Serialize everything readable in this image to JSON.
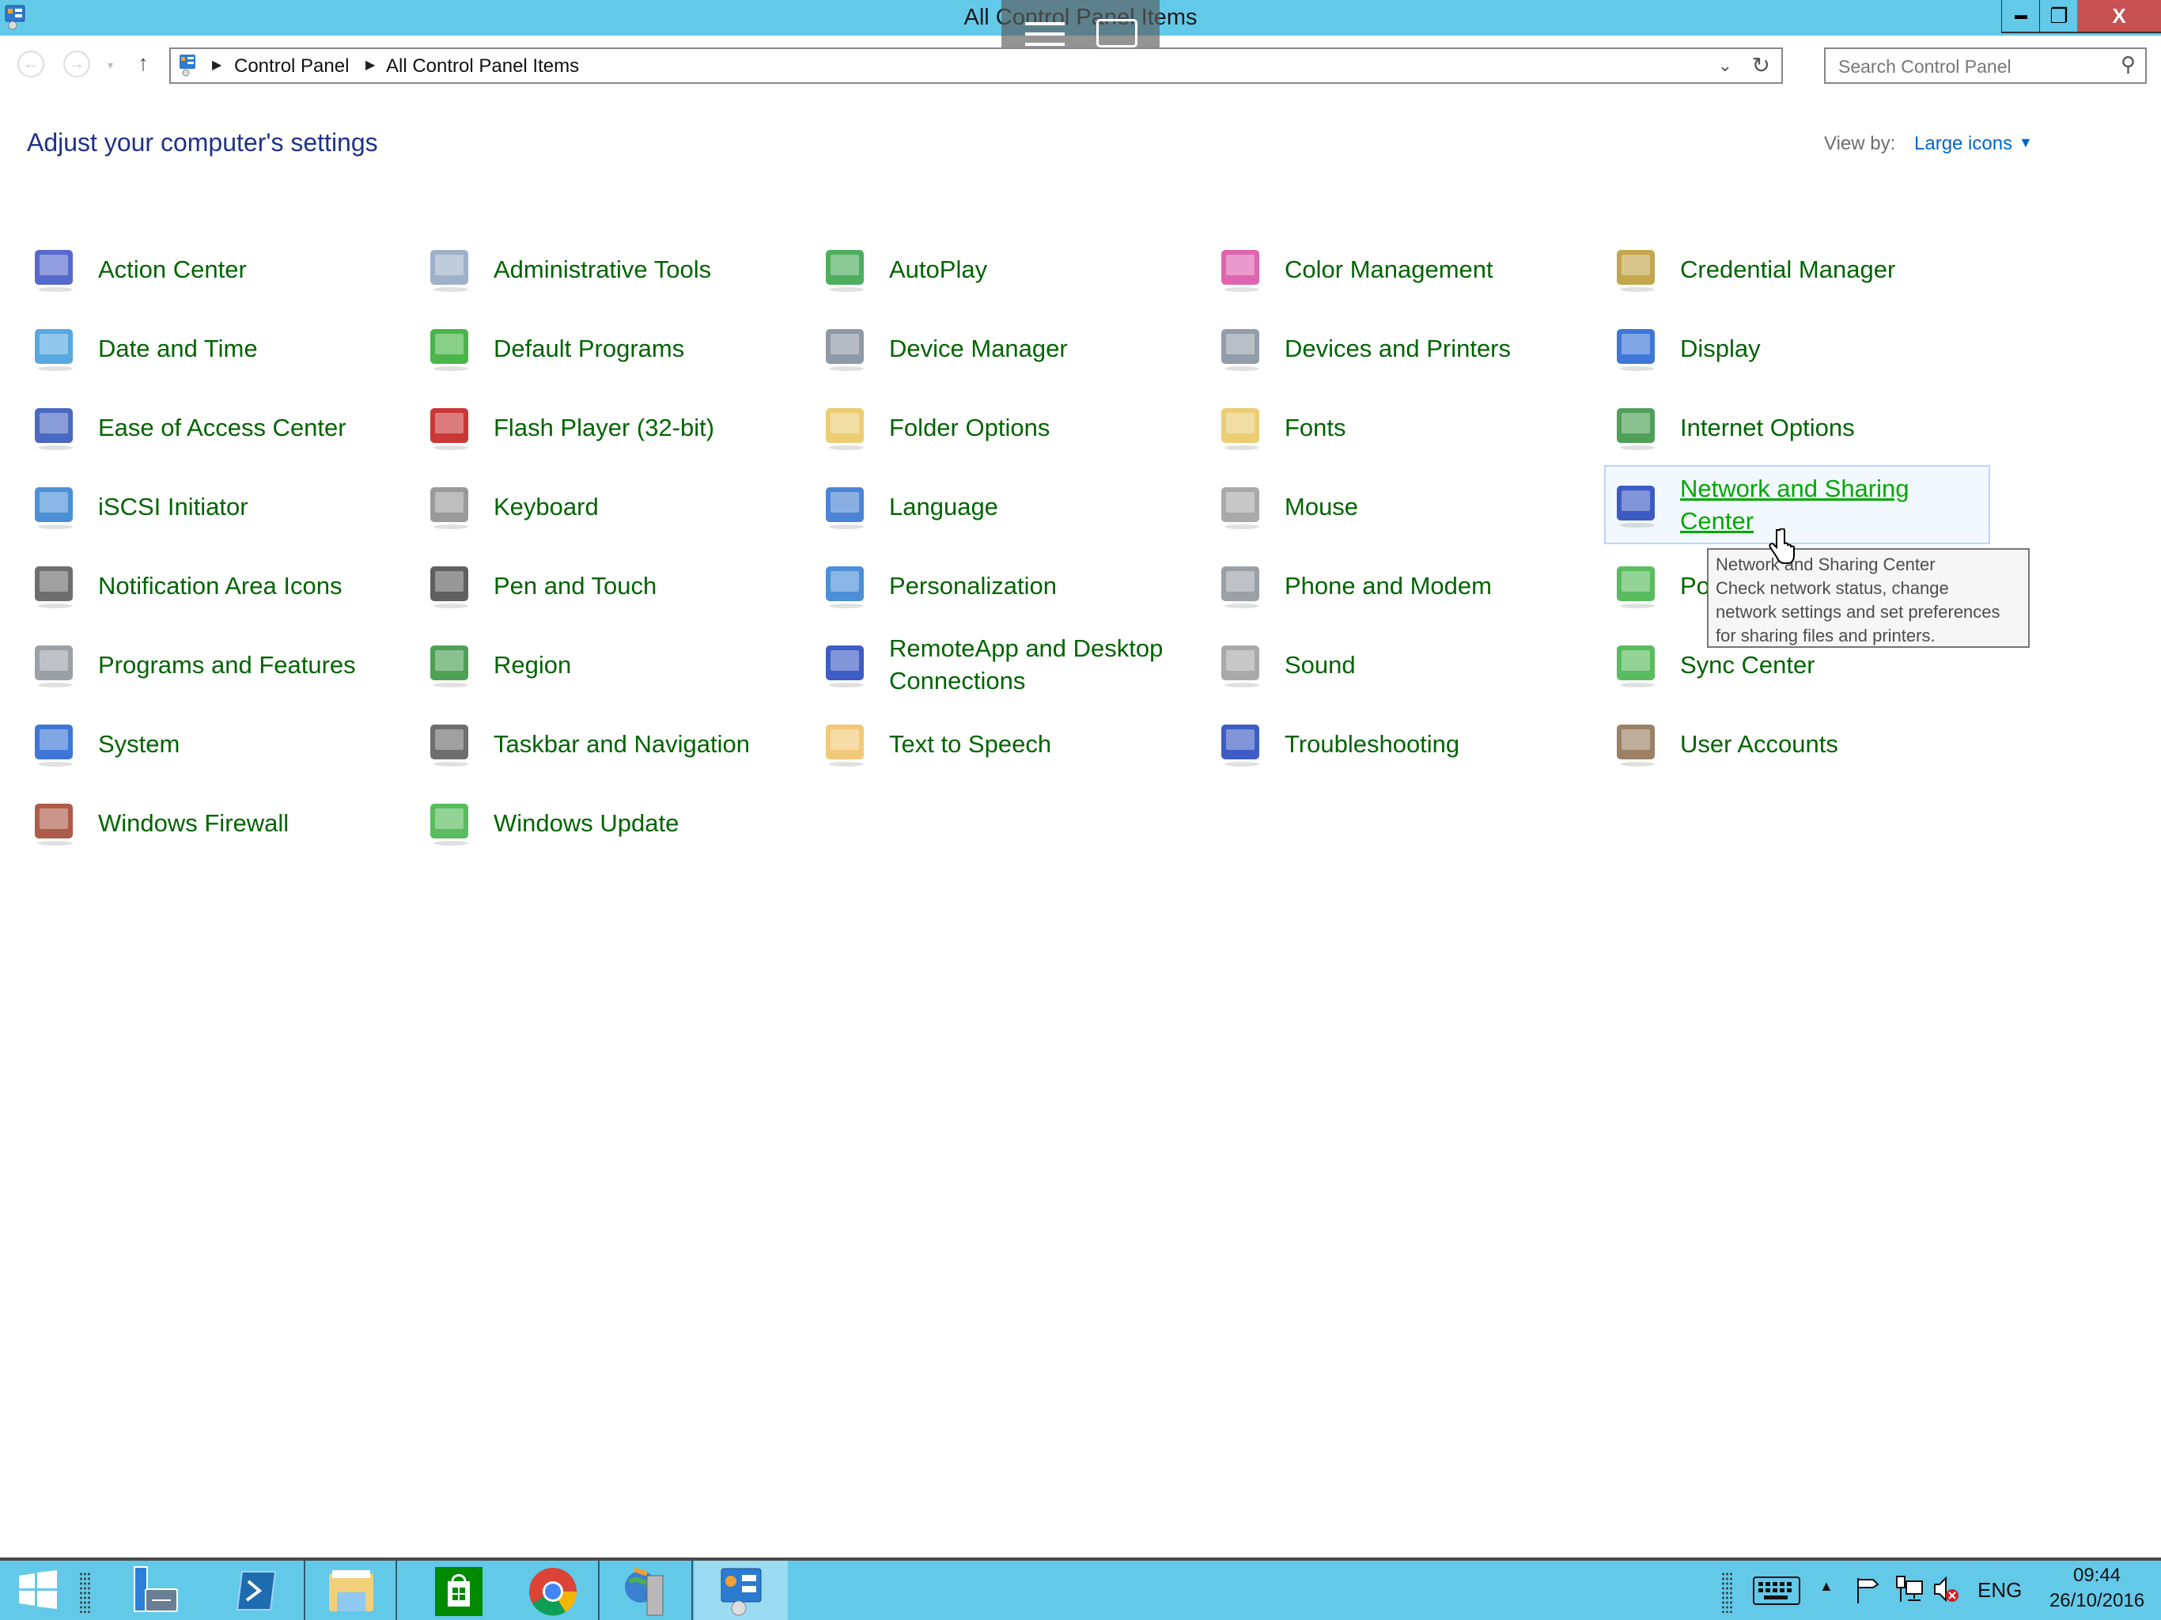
{
  "window": {
    "title": "All Control Panel Items",
    "buttons": {
      "minimize": "▬",
      "restore": "❐",
      "close": "X"
    }
  },
  "nav": {
    "back_icon": "back-arrow-icon",
    "forward_icon": "forward-arrow-icon",
    "recent_icon": "▾",
    "up_icon": "↑",
    "breadcrumb": [
      "Control Panel",
      "All Control Panel Items"
    ],
    "separator": "▶",
    "dropdown_glyph": "⌄",
    "refresh_glyph": "↻",
    "search_placeholder": "Search Control Panel",
    "search_value": "",
    "search_glyph": "⚲"
  },
  "header": {
    "title": "Adjust your computer's settings",
    "view_by_label": "View by:",
    "view_by_value": "Large icons",
    "view_by_caret": "▼"
  },
  "items": [
    {
      "label": "Action Center",
      "icon": "flag-icon",
      "color": "#3a4fc4"
    },
    {
      "label": "Administrative Tools",
      "icon": "admin-tools-icon",
      "color": "#8da3c0"
    },
    {
      "label": "AutoPlay",
      "icon": "autoplay-icon",
      "color": "#2ea043"
    },
    {
      "label": "Color Management",
      "icon": "color-management-icon",
      "color": "#d84aa0"
    },
    {
      "label": "Credential Manager",
      "icon": "credential-vault-icon",
      "color": "#b8962e"
    },
    {
      "label": "Date and Time",
      "icon": "calendar-clock-icon",
      "color": "#3a9ad9"
    },
    {
      "label": "Default Programs",
      "icon": "default-programs-icon",
      "color": "#2aa82a"
    },
    {
      "label": "Device Manager",
      "icon": "device-manager-icon",
      "color": "#7a8796"
    },
    {
      "label": "Devices and Printers",
      "icon": "printer-icon",
      "color": "#7f8c99"
    },
    {
      "label": "Display",
      "icon": "monitor-icon",
      "color": "#1c5fd0"
    },
    {
      "label": "Ease of Access Center",
      "icon": "ease-of-access-icon",
      "color": "#2b4fb8"
    },
    {
      "label": "Flash Player (32-bit)",
      "icon": "flash-player-icon",
      "color": "#c01414"
    },
    {
      "label": "Folder Options",
      "icon": "folder-options-icon",
      "color": "#e8c45c"
    },
    {
      "label": "Fonts",
      "icon": "fonts-folder-icon",
      "color": "#e8c45c"
    },
    {
      "label": "Internet Options",
      "icon": "internet-globe-icon",
      "color": "#2f8f3a"
    },
    {
      "label": "iSCSI Initiator",
      "icon": "iscsi-globe-icon",
      "color": "#2b7bd0"
    },
    {
      "label": "Keyboard",
      "icon": "keyboard-icon",
      "color": "#888888"
    },
    {
      "label": "Language",
      "icon": "language-icon",
      "color": "#2b6fd0"
    },
    {
      "label": "Mouse",
      "icon": "mouse-icon",
      "color": "#9a9a9a"
    },
    {
      "label": "Network and Sharing Center",
      "icon": "network-icon",
      "color": "#1c3fb8",
      "hover": true
    },
    {
      "label": "Notification Area Icons",
      "icon": "notification-icons-icon",
      "color": "#555555"
    },
    {
      "label": "Pen and Touch",
      "icon": "pen-icon",
      "color": "#444444"
    },
    {
      "label": "Personalization",
      "icon": "personalization-icon",
      "color": "#2b7bd0"
    },
    {
      "label": "Phone and Modem",
      "icon": "phone-modem-icon",
      "color": "#8a8f96"
    },
    {
      "label": "Power Options",
      "icon": "battery-plug-icon",
      "color": "#3cb043"
    },
    {
      "label": "Programs and Features",
      "icon": "programs-features-icon",
      "color": "#8a8f96"
    },
    {
      "label": "Region",
      "icon": "region-globe-clock-icon",
      "color": "#2f8f3a"
    },
    {
      "label": "RemoteApp and Desktop Connections",
      "icon": "remote-desktop-icon",
      "color": "#1c3fb8"
    },
    {
      "label": "Sound",
      "icon": "speaker-icon",
      "color": "#9a9a9a"
    },
    {
      "label": "Sync Center",
      "icon": "sync-icon",
      "color": "#3cb043"
    },
    {
      "label": "System",
      "icon": "computer-icon",
      "color": "#1c5fd0"
    },
    {
      "label": "Taskbar and Navigation",
      "icon": "taskbar-icon",
      "color": "#555555"
    },
    {
      "label": "Text to Speech",
      "icon": "speech-bubble-icon",
      "color": "#f0c060"
    },
    {
      "label": "Troubleshooting",
      "icon": "troubleshooting-icon",
      "color": "#1c3fb8"
    },
    {
      "label": "User Accounts",
      "icon": "users-icon",
      "color": "#8a6b4a"
    },
    {
      "label": "Windows Firewall",
      "icon": "firewall-icon",
      "color": "#a0402a"
    },
    {
      "label": "Windows Update",
      "icon": "windows-update-icon",
      "color": "#3cb043"
    }
  ],
  "tooltip": {
    "title": "Network and Sharing Center",
    "lines": [
      "Check network status, change",
      "network settings and set preferences",
      "for sharing files and printers."
    ]
  },
  "taskbar": {
    "apps": [
      {
        "name": "start-button",
        "icon": "windows-logo-icon"
      },
      {
        "name": "server-manager",
        "icon": "server-manager-icon"
      },
      {
        "name": "powershell",
        "icon": "powershell-icon"
      },
      {
        "name": "file-explorer",
        "icon": "file-explorer-icon"
      },
      {
        "name": "store",
        "icon": "store-icon"
      },
      {
        "name": "chrome",
        "icon": "chrome-icon"
      },
      {
        "name": "network-tool",
        "icon": "globe-server-icon"
      },
      {
        "name": "control-panel",
        "icon": "control-panel-icon"
      }
    ],
    "tray": {
      "show_hidden": "▲",
      "language": "ENG",
      "time": "09:44",
      "date": "26/10/2016"
    },
    "colors": {
      "bar": "#63c9e9",
      "active": "#9bdcf3"
    }
  }
}
